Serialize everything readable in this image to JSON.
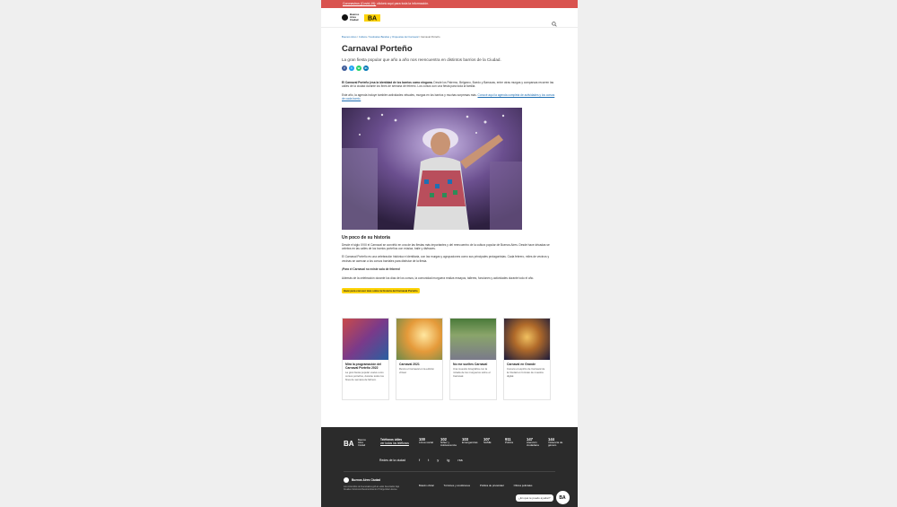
{
  "alert": {
    "link_text": "Coronavirus (Covid-19):",
    "text": "clickeá aquí para toda la información."
  },
  "header": {
    "logo_text": "Buenos Aires Ciudad",
    "ba_logo": "BA",
    "search_icon": "search-icon"
  },
  "breadcrumb": {
    "items": [
      "Buenos Aires",
      "Cultura",
      "Festivales Bandas y Orquestas del Carnaval"
    ],
    "current": "Carnaval Porteño"
  },
  "page": {
    "title": "Carnaval Porteño",
    "subtitle": "La gran fiesta popular que año a año nos reencuentra en distintos barrios de la Ciudad.",
    "share": [
      "f",
      "t",
      "w",
      "in"
    ]
  },
  "intro": {
    "p1_bold": "El Carnaval Porteño (esa la identidad de los barrios como ninguna.",
    "p1_rest": "Desde los Palermo, Belgrano, Boedo y Barracas, entre otras murgas y comparsas recorren las calles de la ciudad durante los fines de semana de febrero. Los corsos son una fiesta para toda la familia.",
    "p2": "Este año, la agenda incluye también actividades virtuales, murgas en los barrios y muchas sorpresas más.",
    "p2_link": "Conocé aquí la agenda completa de actividades y los corsos de cada barrio."
  },
  "history": {
    "heading": "Un poco de su historia",
    "p1": "Desde el siglo XVIII el Carnaval se convirtió en una de las fiestas más importantes y del reencuentro de la cultura popular de Buenos Aires. Desde hace décadas se celebra en las calles de los barrios porteños con música, baile y disfraces.",
    "p2": "El Carnaval Porteño es una celebración histórica e identitaria, con las murgas y agrupaciones como sus principales protagonistas. Cada febrero, miles de vecinos y vecinas se acercan a los corsos barriales para disfrutar de la fiesta.",
    "p3": "¡Para el Carnaval no existe sola de febrero!",
    "p4": "Además de la celebración durante los días de los corsos, la comunidad murguera realiza ensayos, talleres, funciones y actividades durante todo el año.",
    "button": "Hacé para conocer más sobre la historia del Carnaval Porteño"
  },
  "cards": [
    {
      "title": "Mirá la programación del Carnaval Porteño 2022",
      "desc": "La gran fiesta popular vuelve a los corsos porteños, durante todos los fines de semana de febrero."
    },
    {
      "title": "Carnaval 2021",
      "desc": "Revivi el Carnaval en la edición virtual."
    },
    {
      "title": "No me sueltes Carnaval",
      "desc": "Una muestra fotográfica con la mirada de los murgueros sobre el Carnaval."
    },
    {
      "title": "Carnaval en Grande",
      "desc": "Conocé el espíritu de Carnaval de la Ciudad en formato de muestra digital."
    }
  ],
  "footer": {
    "ba_logo": "BA",
    "ba_text": "Buenos Aires Ciudad",
    "phones_label": "Teléfonos útiles",
    "phones_link": "ver todos los teléfonos",
    "numbers": [
      {
        "n": "100",
        "l": "Línea social"
      },
      {
        "n": "102",
        "l": "Niñez y Adolescencia"
      },
      {
        "n": "103",
        "l": "Emergencias"
      },
      {
        "n": "107",
        "l": "SAME"
      },
      {
        "n": "911",
        "l": "Policía"
      },
      {
        "n": "147",
        "l": "Atención ciudadana"
      },
      {
        "n": "144",
        "l": "Violencia de género"
      }
    ],
    "social_label": "Redes de la ciudad",
    "social": [
      "f",
      "t",
      "y",
      "ig",
      "rss"
    ],
    "bottom_logo": "Buenos Aires Ciudad",
    "legal": "Los contenidos de buenosaires.gob.ar están licenciados bajo Creative Commons Reconocimiento 2.5 Argentina License.",
    "links": [
      "Boletín oficial",
      "Términos y condiciones",
      "Política de privacidad",
      "Oficios judiciales"
    ],
    "chat_text": "¿En qué te puedo ayudar?",
    "chat_logo": "BA"
  }
}
